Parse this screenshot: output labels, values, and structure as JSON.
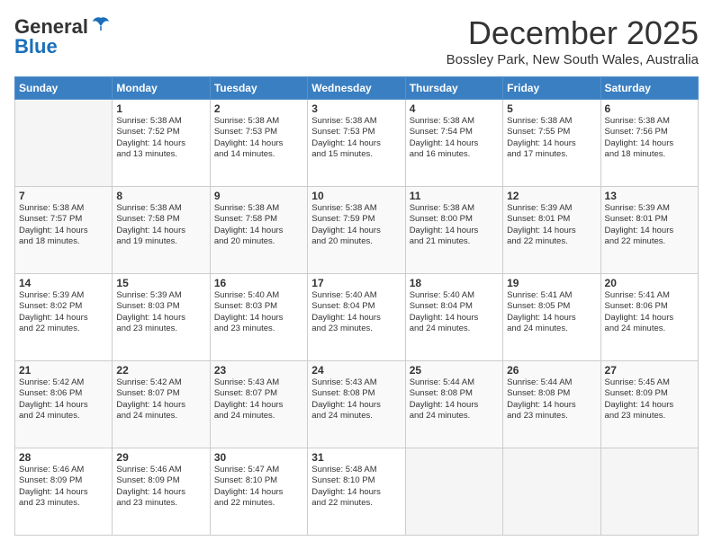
{
  "header": {
    "logo_general": "General",
    "logo_blue": "Blue",
    "month_title": "December 2025",
    "location": "Bossley Park, New South Wales, Australia"
  },
  "days_of_week": [
    "Sunday",
    "Monday",
    "Tuesday",
    "Wednesday",
    "Thursday",
    "Friday",
    "Saturday"
  ],
  "weeks": [
    [
      {
        "day": "",
        "info": ""
      },
      {
        "day": "1",
        "info": "Sunrise: 5:38 AM\nSunset: 7:52 PM\nDaylight: 14 hours\nand 13 minutes."
      },
      {
        "day": "2",
        "info": "Sunrise: 5:38 AM\nSunset: 7:53 PM\nDaylight: 14 hours\nand 14 minutes."
      },
      {
        "day": "3",
        "info": "Sunrise: 5:38 AM\nSunset: 7:53 PM\nDaylight: 14 hours\nand 15 minutes."
      },
      {
        "day": "4",
        "info": "Sunrise: 5:38 AM\nSunset: 7:54 PM\nDaylight: 14 hours\nand 16 minutes."
      },
      {
        "day": "5",
        "info": "Sunrise: 5:38 AM\nSunset: 7:55 PM\nDaylight: 14 hours\nand 17 minutes."
      },
      {
        "day": "6",
        "info": "Sunrise: 5:38 AM\nSunset: 7:56 PM\nDaylight: 14 hours\nand 18 minutes."
      }
    ],
    [
      {
        "day": "7",
        "info": "Sunrise: 5:38 AM\nSunset: 7:57 PM\nDaylight: 14 hours\nand 18 minutes."
      },
      {
        "day": "8",
        "info": "Sunrise: 5:38 AM\nSunset: 7:58 PM\nDaylight: 14 hours\nand 19 minutes."
      },
      {
        "day": "9",
        "info": "Sunrise: 5:38 AM\nSunset: 7:58 PM\nDaylight: 14 hours\nand 20 minutes."
      },
      {
        "day": "10",
        "info": "Sunrise: 5:38 AM\nSunset: 7:59 PM\nDaylight: 14 hours\nand 20 minutes."
      },
      {
        "day": "11",
        "info": "Sunrise: 5:38 AM\nSunset: 8:00 PM\nDaylight: 14 hours\nand 21 minutes."
      },
      {
        "day": "12",
        "info": "Sunrise: 5:39 AM\nSunset: 8:01 PM\nDaylight: 14 hours\nand 22 minutes."
      },
      {
        "day": "13",
        "info": "Sunrise: 5:39 AM\nSunset: 8:01 PM\nDaylight: 14 hours\nand 22 minutes."
      }
    ],
    [
      {
        "day": "14",
        "info": "Sunrise: 5:39 AM\nSunset: 8:02 PM\nDaylight: 14 hours\nand 22 minutes."
      },
      {
        "day": "15",
        "info": "Sunrise: 5:39 AM\nSunset: 8:03 PM\nDaylight: 14 hours\nand 23 minutes."
      },
      {
        "day": "16",
        "info": "Sunrise: 5:40 AM\nSunset: 8:03 PM\nDaylight: 14 hours\nand 23 minutes."
      },
      {
        "day": "17",
        "info": "Sunrise: 5:40 AM\nSunset: 8:04 PM\nDaylight: 14 hours\nand 23 minutes."
      },
      {
        "day": "18",
        "info": "Sunrise: 5:40 AM\nSunset: 8:04 PM\nDaylight: 14 hours\nand 24 minutes."
      },
      {
        "day": "19",
        "info": "Sunrise: 5:41 AM\nSunset: 8:05 PM\nDaylight: 14 hours\nand 24 minutes."
      },
      {
        "day": "20",
        "info": "Sunrise: 5:41 AM\nSunset: 8:06 PM\nDaylight: 14 hours\nand 24 minutes."
      }
    ],
    [
      {
        "day": "21",
        "info": "Sunrise: 5:42 AM\nSunset: 8:06 PM\nDaylight: 14 hours\nand 24 minutes."
      },
      {
        "day": "22",
        "info": "Sunrise: 5:42 AM\nSunset: 8:07 PM\nDaylight: 14 hours\nand 24 minutes."
      },
      {
        "day": "23",
        "info": "Sunrise: 5:43 AM\nSunset: 8:07 PM\nDaylight: 14 hours\nand 24 minutes."
      },
      {
        "day": "24",
        "info": "Sunrise: 5:43 AM\nSunset: 8:08 PM\nDaylight: 14 hours\nand 24 minutes."
      },
      {
        "day": "25",
        "info": "Sunrise: 5:44 AM\nSunset: 8:08 PM\nDaylight: 14 hours\nand 24 minutes."
      },
      {
        "day": "26",
        "info": "Sunrise: 5:44 AM\nSunset: 8:08 PM\nDaylight: 14 hours\nand 23 minutes."
      },
      {
        "day": "27",
        "info": "Sunrise: 5:45 AM\nSunset: 8:09 PM\nDaylight: 14 hours\nand 23 minutes."
      }
    ],
    [
      {
        "day": "28",
        "info": "Sunrise: 5:46 AM\nSunset: 8:09 PM\nDaylight: 14 hours\nand 23 minutes."
      },
      {
        "day": "29",
        "info": "Sunrise: 5:46 AM\nSunset: 8:09 PM\nDaylight: 14 hours\nand 23 minutes."
      },
      {
        "day": "30",
        "info": "Sunrise: 5:47 AM\nSunset: 8:10 PM\nDaylight: 14 hours\nand 22 minutes."
      },
      {
        "day": "31",
        "info": "Sunrise: 5:48 AM\nSunset: 8:10 PM\nDaylight: 14 hours\nand 22 minutes."
      },
      {
        "day": "",
        "info": ""
      },
      {
        "day": "",
        "info": ""
      },
      {
        "day": "",
        "info": ""
      }
    ]
  ]
}
